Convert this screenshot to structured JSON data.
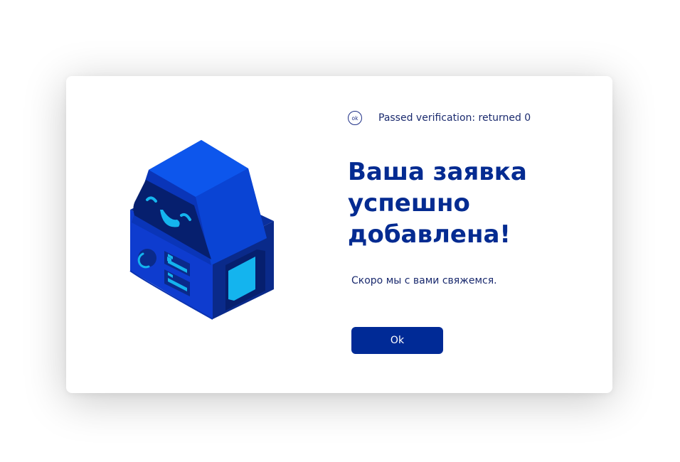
{
  "status": {
    "badge": "ok",
    "text": "Passed verification: returned 0"
  },
  "dialog": {
    "title": "Ваша заявка успешно добавлена!",
    "subtitle": "Скоро мы с вами свяжемся.",
    "ok_label": "Ok"
  },
  "colors": {
    "accent": "#042b91",
    "button": "#002a96",
    "robot_light": "#0d56ec",
    "robot_dark": "#0a2a8a",
    "robot_screen": "#14b4ee"
  },
  "illustration": {
    "icon": "robot-server-icon"
  }
}
